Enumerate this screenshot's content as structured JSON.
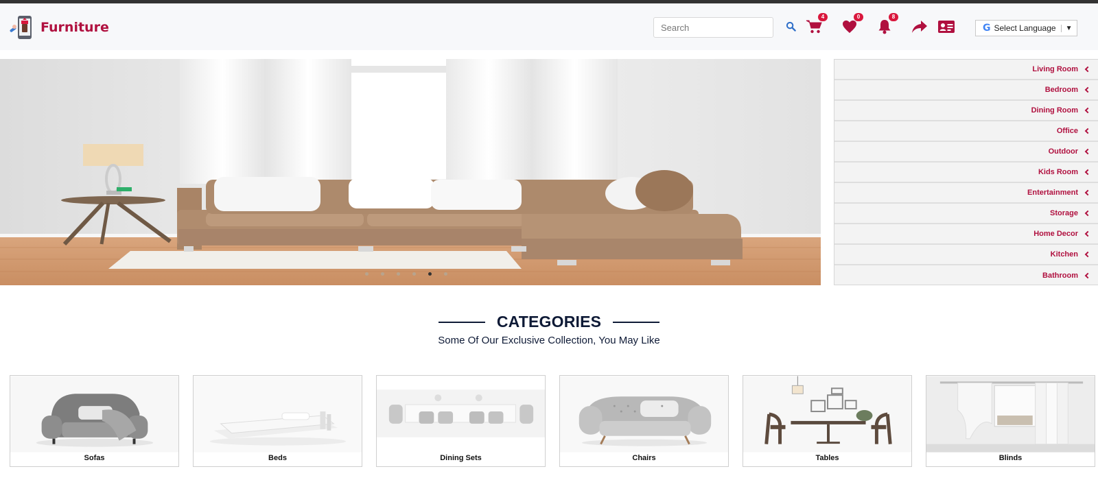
{
  "brand": {
    "name": "Furniture"
  },
  "header": {
    "search_placeholder": "Search",
    "cart_count": "4",
    "wishlist_count": "0",
    "notification_count": "8",
    "language_label": "Select Language",
    "google_glyph": "G",
    "caret": "▼"
  },
  "categories_menu": [
    "Living Room",
    "Bedroom",
    "Dining Room",
    "Office",
    "Outdoor",
    "Kids Room",
    "Entertainment",
    "Storage",
    "Home Decor",
    "Kitchen",
    "Bathroom"
  ],
  "hero": {
    "slide_count": 6,
    "active_slide": 5
  },
  "section": {
    "title": "CATEGORIES",
    "subtitle": "Some Of Our Exclusive Collection, You May Like"
  },
  "category_cards": [
    "Sofas",
    "Beds",
    "Dining Sets",
    "Chairs",
    "Tables",
    "Blinds"
  ],
  "colors": {
    "brand": "#b0103f",
    "badge": "#d9173c",
    "heading": "#0e1a36"
  }
}
